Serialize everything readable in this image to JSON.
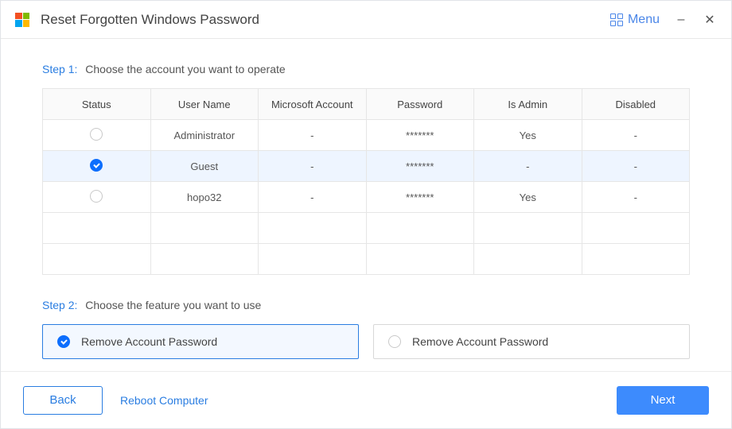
{
  "title": "Reset Forgotten Windows Password",
  "menu_label": "Menu",
  "step1": {
    "label": "Step 1:",
    "desc": "Choose the account you want to operate"
  },
  "headers": {
    "status": "Status",
    "user": "User Name",
    "ms": "Microsoft Account",
    "pw": "Password",
    "admin": "Is Admin",
    "disabled": "Disabled"
  },
  "rows": [
    {
      "selected": false,
      "user": "Administrator",
      "ms": "-",
      "pw": "*******",
      "admin": "Yes",
      "disabled": "-"
    },
    {
      "selected": true,
      "user": "Guest",
      "ms": "-",
      "pw": "*******",
      "admin": "-",
      "disabled": "-"
    },
    {
      "selected": false,
      "user": "hopo32",
      "ms": "-",
      "pw": "*******",
      "admin": "Yes",
      "disabled": "-"
    }
  ],
  "step2": {
    "label": "Step 2:",
    "desc": "Choose the feature you want to use"
  },
  "features": [
    {
      "label": "Remove Account Password",
      "selected": true
    },
    {
      "label": "Remove Account Password",
      "selected": false
    }
  ],
  "footer": {
    "back": "Back",
    "reboot": "Reboot Computer",
    "next": "Next"
  }
}
